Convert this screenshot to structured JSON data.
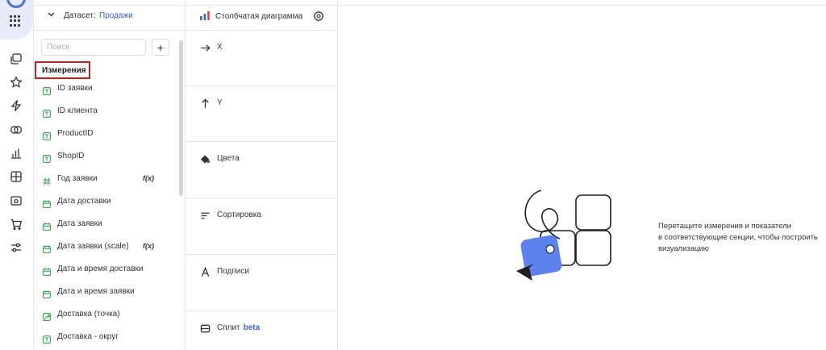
{
  "rail": {
    "icons": [
      "logo-icon",
      "apps-grid-icon",
      "collections-icon",
      "favorites-star-icon",
      "connections-bolt-icon",
      "datasets-rings-icon",
      "charts-bars-icon",
      "dashboards-grid-icon",
      "folder-icon",
      "cart-icon",
      "settings-sliders-icon"
    ]
  },
  "dataset": {
    "label": "Датасет:",
    "name": "Продажи",
    "search_placeholder": "Поиск",
    "add_label": "+",
    "section_title": "Измерения",
    "fields": [
      {
        "label": "ID заявки",
        "type": "text",
        "fx": ""
      },
      {
        "label": "ID клиента",
        "type": "text",
        "fx": ""
      },
      {
        "label": "ProductID",
        "type": "text",
        "fx": ""
      },
      {
        "label": "ShopID",
        "type": "text",
        "fx": ""
      },
      {
        "label": "Год заявки",
        "type": "number",
        "fx": "f(x)"
      },
      {
        "label": "Дата доставки",
        "type": "date",
        "fx": ""
      },
      {
        "label": "Дата заявки",
        "type": "date",
        "fx": ""
      },
      {
        "label": "Дата заявки (scale)",
        "type": "date",
        "fx": "f(x)"
      },
      {
        "label": "Дата и время доставки",
        "type": "date",
        "fx": ""
      },
      {
        "label": "Дата и время заявки",
        "type": "date",
        "fx": ""
      },
      {
        "label": "Доставка (точка)",
        "type": "geo",
        "fx": ""
      },
      {
        "label": "Доставка - округ",
        "type": "text",
        "fx": ""
      }
    ]
  },
  "chart": {
    "type_label": "Столбчатая диаграмма",
    "sections": [
      {
        "label": "X",
        "icon": "arrow-right-icon"
      },
      {
        "label": "Y",
        "icon": "arrow-up-icon"
      },
      {
        "label": "Цвета",
        "icon": "paint-bucket-icon"
      },
      {
        "label": "Сортировка",
        "icon": "sort-lines-icon"
      },
      {
        "label": "Подписи",
        "icon": "letter-a-icon"
      },
      {
        "label": "Сплит",
        "icon": "split-icon",
        "badge": "beta"
      }
    ]
  },
  "empty_state": {
    "line1": "Перетащите измерения и показатели",
    "line2": "в соответствующие секции, чтобы построить",
    "line3": "визуализацию"
  },
  "colors": {
    "accent": "#3b63d9",
    "field_icon": "#2fa84f",
    "highlight_border": "#c41f1f",
    "illustration_blue": "#5b82ee"
  }
}
